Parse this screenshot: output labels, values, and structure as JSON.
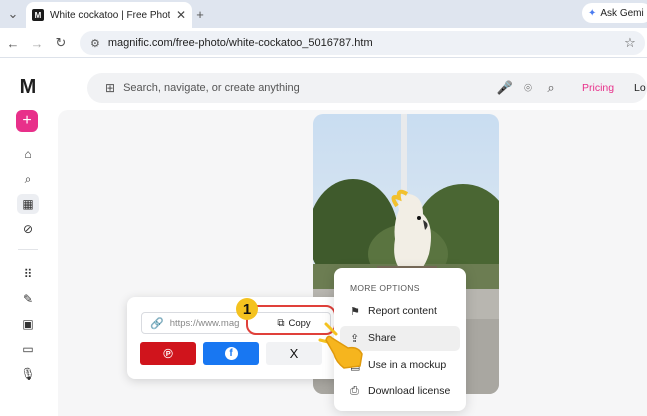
{
  "browser": {
    "tab_title": "White cockatoo | Free Photo",
    "favicon": "M",
    "ask_gemini": "Ask Gemi",
    "url": "magnific.com/free-photo/white-cockatoo_5016787.htm"
  },
  "site": {
    "logo": "M",
    "search_placeholder": "Search, navigate, or create anything",
    "pricing": "Pricing",
    "login": "Lo",
    "accent": "#e8308a"
  },
  "share": {
    "url_text": "https://www.mag",
    "copy_label": "Copy",
    "step_badge": "1",
    "pinterest_color": "#d0141c",
    "facebook_color": "#1877f2",
    "x_label": "X"
  },
  "menu": {
    "header": "MORE OPTIONS",
    "items": [
      "Report content",
      "Share",
      "Use in a mockup",
      "Download license"
    ]
  }
}
